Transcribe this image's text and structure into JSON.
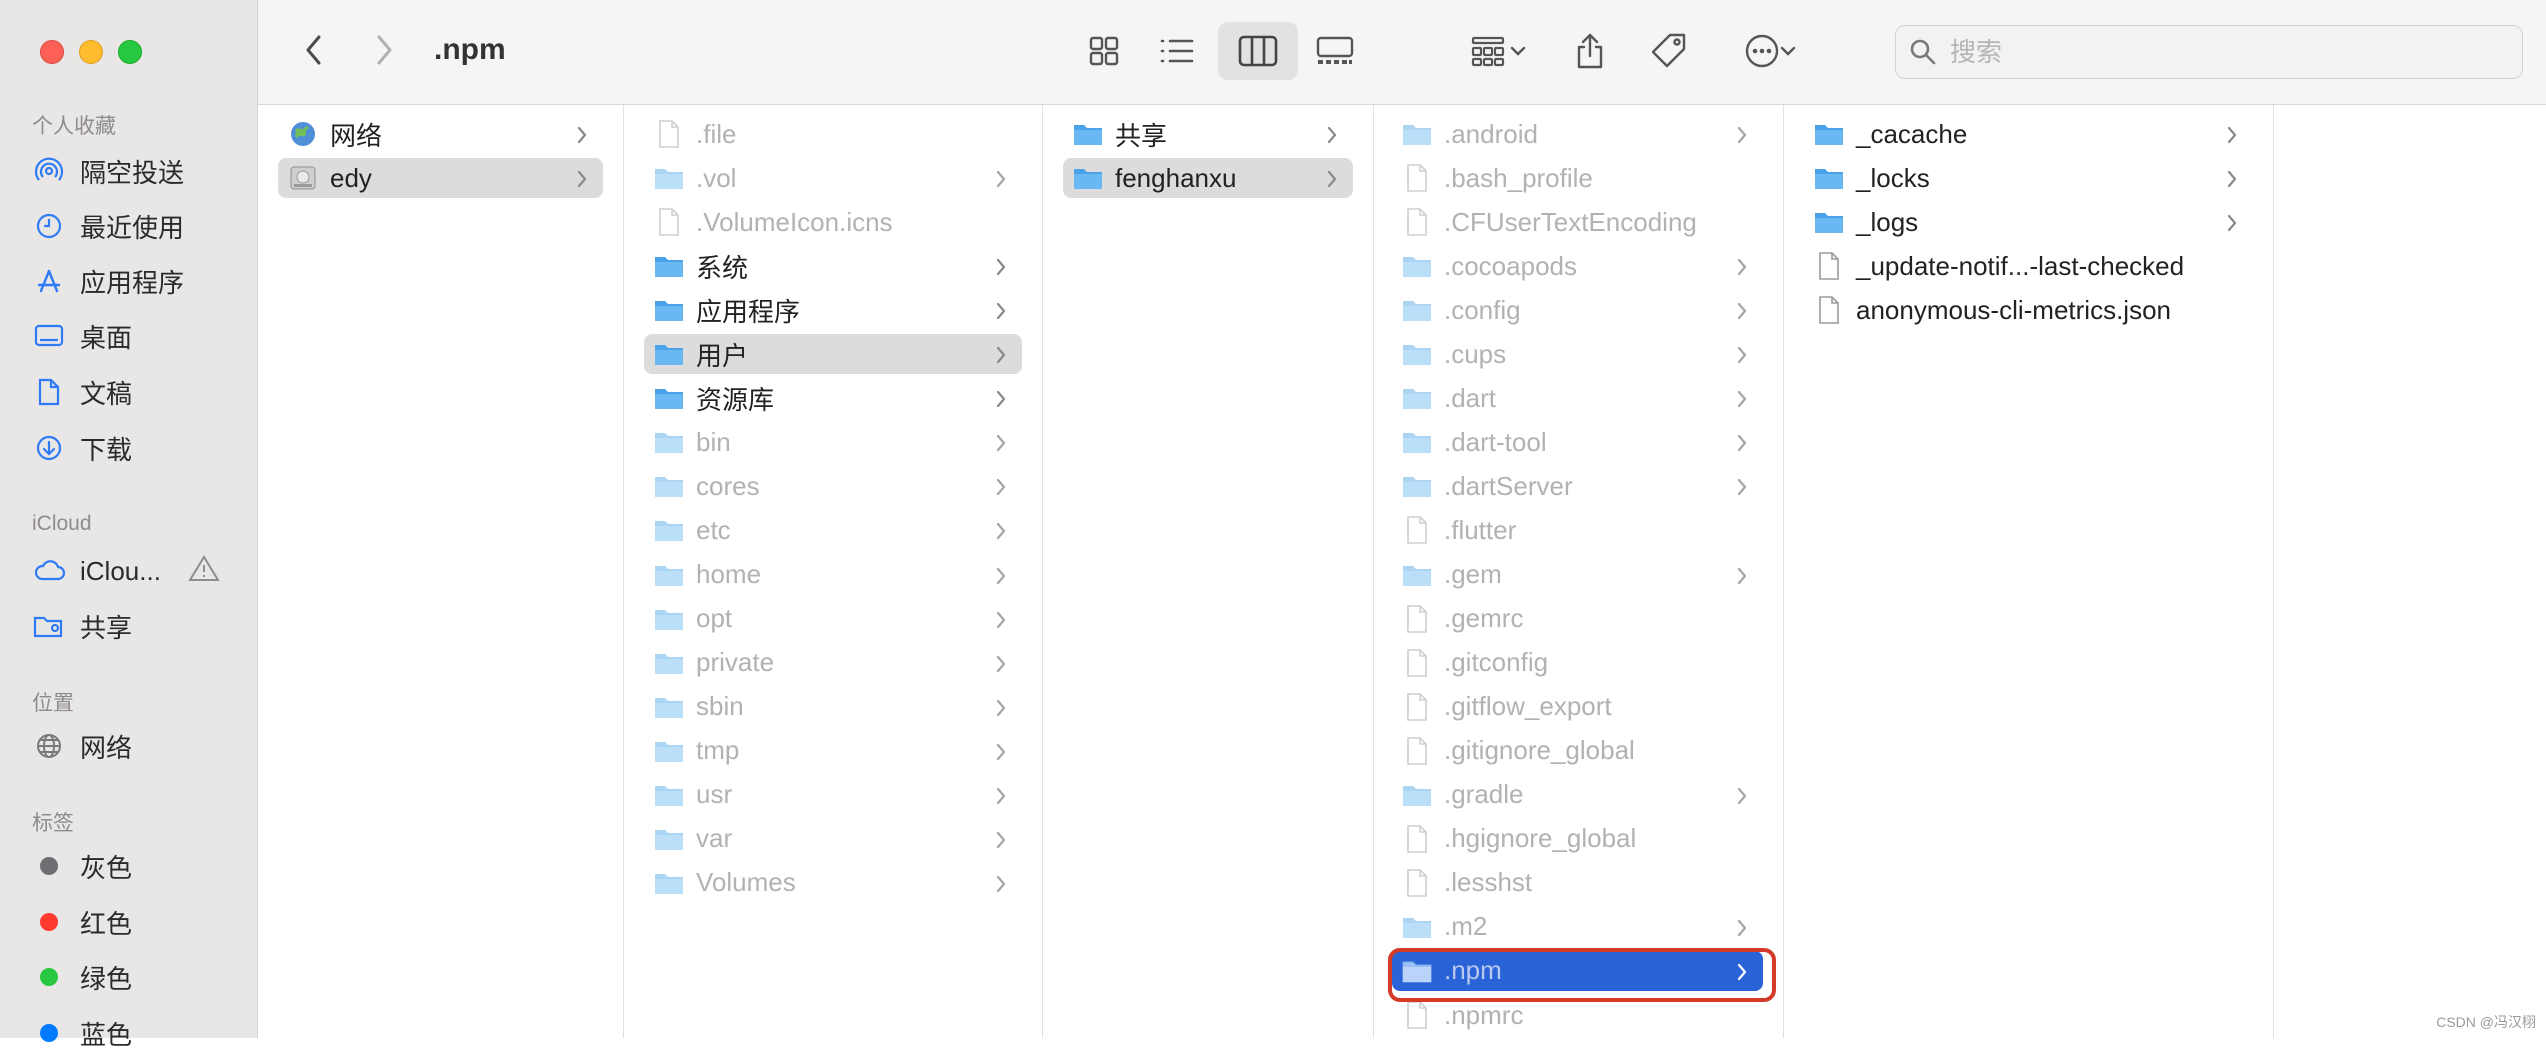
{
  "window": {
    "title": ".npm"
  },
  "sidebar": {
    "sections": [
      {
        "title": "个人收藏",
        "items": [
          {
            "label": "隔空投送",
            "icon": "airdrop-icon"
          },
          {
            "label": "最近使用",
            "icon": "clock-icon"
          },
          {
            "label": "应用程序",
            "icon": "apps-icon"
          },
          {
            "label": "桌面",
            "icon": "desktop-icon"
          },
          {
            "label": "文稿",
            "icon": "document-icon"
          },
          {
            "label": "下载",
            "icon": "download-icon"
          }
        ]
      },
      {
        "title": "iCloud",
        "items": [
          {
            "label": "iClou...",
            "icon": "cloud-icon"
          },
          {
            "label": "共享",
            "icon": "shared-folder-icon"
          }
        ]
      },
      {
        "title": "位置",
        "items": [
          {
            "label": "网络",
            "icon": "globe-icon"
          }
        ]
      },
      {
        "title": "标签",
        "items": [
          {
            "label": "灰色",
            "color": "#6e6e73"
          },
          {
            "label": "红色",
            "color": "#ff3b30"
          },
          {
            "label": "绿色",
            "color": "#28c840"
          },
          {
            "label": "蓝色",
            "color": "#007aff"
          }
        ]
      }
    ]
  },
  "search": {
    "placeholder": "搜索"
  },
  "columns": [
    {
      "items": [
        {
          "name": "网络",
          "icon": "globe",
          "style": "norm",
          "chevron": true
        },
        {
          "name": "edy",
          "icon": "disk",
          "style": "sel-gray",
          "chevron": true
        }
      ]
    },
    {
      "items": [
        {
          "name": ".file",
          "icon": "file",
          "style": "dim",
          "chevron": false
        },
        {
          "name": ".vol",
          "icon": "folder",
          "style": "dim",
          "chevron": true
        },
        {
          "name": ".VolumeIcon.icns",
          "icon": "file",
          "style": "dim",
          "chevron": false
        },
        {
          "name": "系统",
          "icon": "folder",
          "style": "norm",
          "chevron": true
        },
        {
          "name": "应用程序",
          "icon": "folder",
          "style": "norm",
          "chevron": true
        },
        {
          "name": "用户",
          "icon": "folder",
          "style": "sel-gray",
          "chevron": true
        },
        {
          "name": "资源库",
          "icon": "folder",
          "style": "norm",
          "chevron": true
        },
        {
          "name": "bin",
          "icon": "folder",
          "style": "dim",
          "chevron": true
        },
        {
          "name": "cores",
          "icon": "folder",
          "style": "dim",
          "chevron": true
        },
        {
          "name": "etc",
          "icon": "folder",
          "style": "dim",
          "chevron": true
        },
        {
          "name": "home",
          "icon": "folder",
          "style": "dim",
          "chevron": true
        },
        {
          "name": "opt",
          "icon": "folder",
          "style": "dim",
          "chevron": true
        },
        {
          "name": "private",
          "icon": "folder",
          "style": "dim",
          "chevron": true
        },
        {
          "name": "sbin",
          "icon": "folder",
          "style": "dim",
          "chevron": true
        },
        {
          "name": "tmp",
          "icon": "folder",
          "style": "dim",
          "chevron": true
        },
        {
          "name": "usr",
          "icon": "folder",
          "style": "dim",
          "chevron": true
        },
        {
          "name": "var",
          "icon": "folder",
          "style": "dim",
          "chevron": true
        },
        {
          "name": "Volumes",
          "icon": "folder",
          "style": "dim",
          "chevron": true
        }
      ]
    },
    {
      "items": [
        {
          "name": "共享",
          "icon": "folder",
          "style": "norm",
          "chevron": true
        },
        {
          "name": "fenghanxu",
          "icon": "folder",
          "style": "sel-gray",
          "chevron": true
        }
      ]
    },
    {
      "items": [
        {
          "name": ".android",
          "icon": "folder",
          "style": "dim",
          "chevron": true
        },
        {
          "name": ".bash_profile",
          "icon": "file",
          "style": "dim",
          "chevron": false
        },
        {
          "name": ".CFUserTextEncoding",
          "icon": "file",
          "style": "dim",
          "chevron": false
        },
        {
          "name": ".cocoapods",
          "icon": "folder",
          "style": "dim",
          "chevron": true
        },
        {
          "name": ".config",
          "icon": "folder",
          "style": "dim",
          "chevron": true
        },
        {
          "name": ".cups",
          "icon": "folder",
          "style": "dim",
          "chevron": true
        },
        {
          "name": ".dart",
          "icon": "folder",
          "style": "dim",
          "chevron": true
        },
        {
          "name": ".dart-tool",
          "icon": "folder",
          "style": "dim",
          "chevron": true
        },
        {
          "name": ".dartServer",
          "icon": "folder",
          "style": "dim",
          "chevron": true
        },
        {
          "name": ".flutter",
          "icon": "file",
          "style": "dim",
          "chevron": false
        },
        {
          "name": ".gem",
          "icon": "folder",
          "style": "dim",
          "chevron": true
        },
        {
          "name": ".gemrc",
          "icon": "file",
          "style": "dim",
          "chevron": false
        },
        {
          "name": ".gitconfig",
          "icon": "file",
          "style": "dim",
          "chevron": false
        },
        {
          "name": ".gitflow_export",
          "icon": "file",
          "style": "dim",
          "chevron": false
        },
        {
          "name": ".gitignore_global",
          "icon": "file",
          "style": "dim",
          "chevron": false
        },
        {
          "name": ".gradle",
          "icon": "folder",
          "style": "dim",
          "chevron": true
        },
        {
          "name": ".hgignore_global",
          "icon": "file",
          "style": "dim",
          "chevron": false
        },
        {
          "name": ".lesshst",
          "icon": "file",
          "style": "dim",
          "chevron": false
        },
        {
          "name": ".m2",
          "icon": "folder",
          "style": "dim",
          "chevron": true
        },
        {
          "name": ".npm",
          "icon": "folder",
          "style": "sel-blue",
          "chevron": true
        },
        {
          "name": ".npmrc",
          "icon": "file",
          "style": "dim",
          "chevron": false
        }
      ]
    },
    {
      "items": [
        {
          "name": "_cacache",
          "icon": "folder",
          "style": "norm",
          "chevron": true
        },
        {
          "name": "_locks",
          "icon": "folder",
          "style": "norm",
          "chevron": true
        },
        {
          "name": "_logs",
          "icon": "folder",
          "style": "norm",
          "chevron": true
        },
        {
          "name": "_update-notif...-last-checked",
          "icon": "file",
          "style": "norm",
          "chevron": false
        },
        {
          "name": "anonymous-cli-metrics.json",
          "icon": "file",
          "style": "norm",
          "chevron": false
        }
      ]
    }
  ],
  "watermark": "CSDN @冯汉栩"
}
